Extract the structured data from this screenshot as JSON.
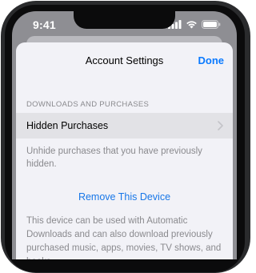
{
  "status_bar": {
    "time": "9:41",
    "icons": [
      "cellular-signal-icon",
      "wifi-icon",
      "battery-icon"
    ]
  },
  "sheet": {
    "nav": {
      "title": "Account Settings",
      "done_label": "Done"
    },
    "section": {
      "header": "DOWNLOADS AND PURCHASES",
      "row_label": "Hidden Purchases",
      "row_icon": "chevron-right-icon",
      "footer": "Unhide purchases that you have previously hidden."
    },
    "action_label": "Remove This Device",
    "footer_2": "This device can be used with Automatic Downloads and can also download previously purchased music, apps, movies, TV shows, and books."
  },
  "colors": {
    "accent": "#0a7aff",
    "secondary_text": "#8a8a8e",
    "sheet_background": "#f2f2f7",
    "highlight_row": "#e2e2e6"
  }
}
